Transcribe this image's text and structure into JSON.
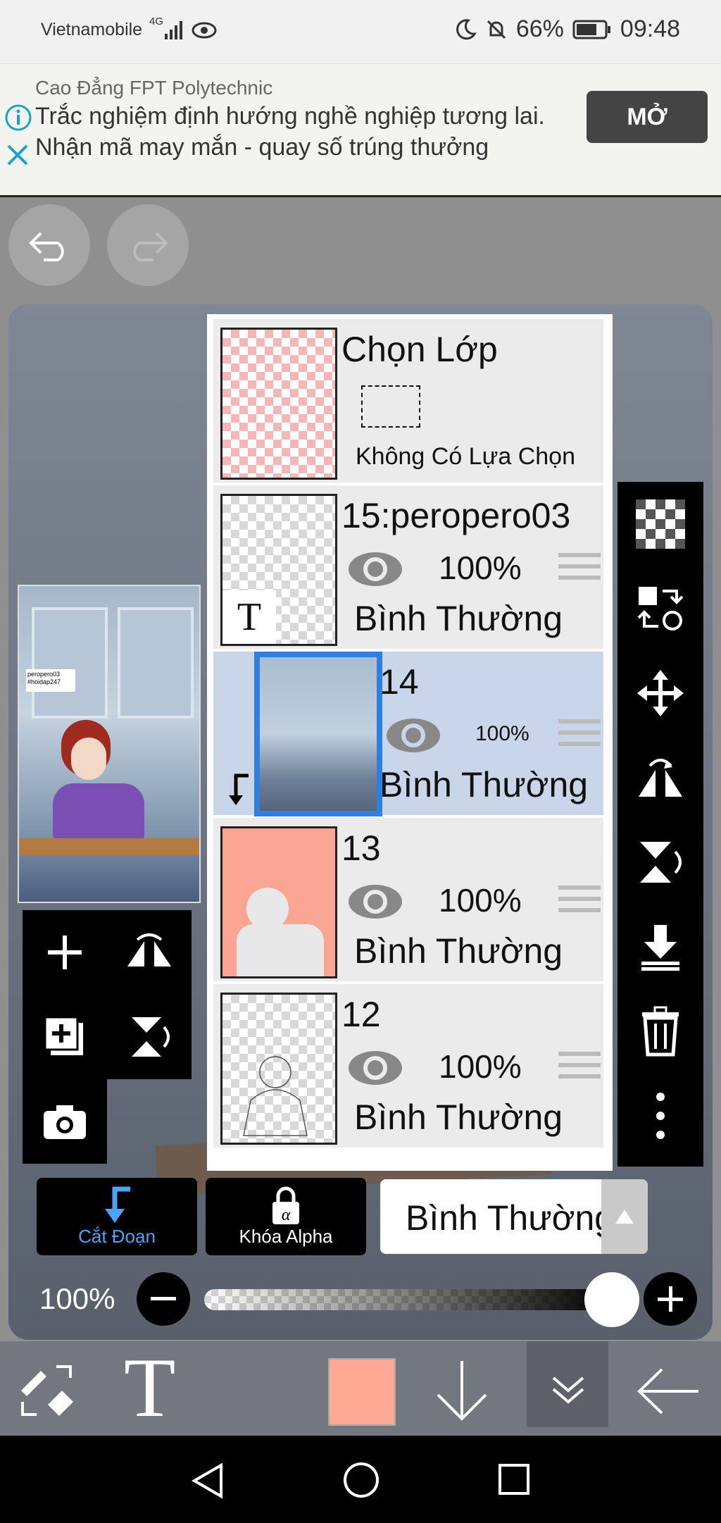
{
  "status_bar": {
    "carrier": "Vietnamobile",
    "network": "4G",
    "battery": "66%",
    "time": "09:48"
  },
  "ad": {
    "brand": "Cao Đẳng FPT Polytechnic",
    "text": "Trắc nghiệm định hướng nghề nghiệp tương lai. Nhận mã may mắn - quay số trúng thưởng",
    "button": "MỞ"
  },
  "layers": [
    {
      "name": "Chọn Lớp",
      "subtitle": "Không Có Lựa Chọn"
    },
    {
      "name": "15:peropero03",
      "opacity": "100%",
      "blend": "Bình Thường"
    },
    {
      "name": "14",
      "opacity": "100%",
      "blend": "Bình Thường",
      "selected": true
    },
    {
      "name": "13",
      "opacity": "100%",
      "blend": "Bình Thường"
    },
    {
      "name": "12",
      "opacity": "100%",
      "blend": "Bình Thường"
    }
  ],
  "thumb_caption": "peropero03 #hoidap247",
  "controls": {
    "clipping_label": "Cắt Đoạn",
    "alpha_lock_label": "Khóa Alpha",
    "blend_mode": "Bình Thường",
    "opacity": "100%"
  },
  "colors": {
    "accent": "#2f7fe0",
    "current_color": "#ffa894",
    "selection": "#c9d6ea"
  },
  "icons": [
    "undo-icon",
    "redo-icon",
    "checker-icon",
    "transfer-icon",
    "move-icon",
    "flip-h-icon",
    "flip-v-icon",
    "merge-down-icon",
    "trash-icon",
    "more-icon",
    "add-layer-icon",
    "add-copy-icon",
    "camera-icon",
    "eye-icon"
  ]
}
